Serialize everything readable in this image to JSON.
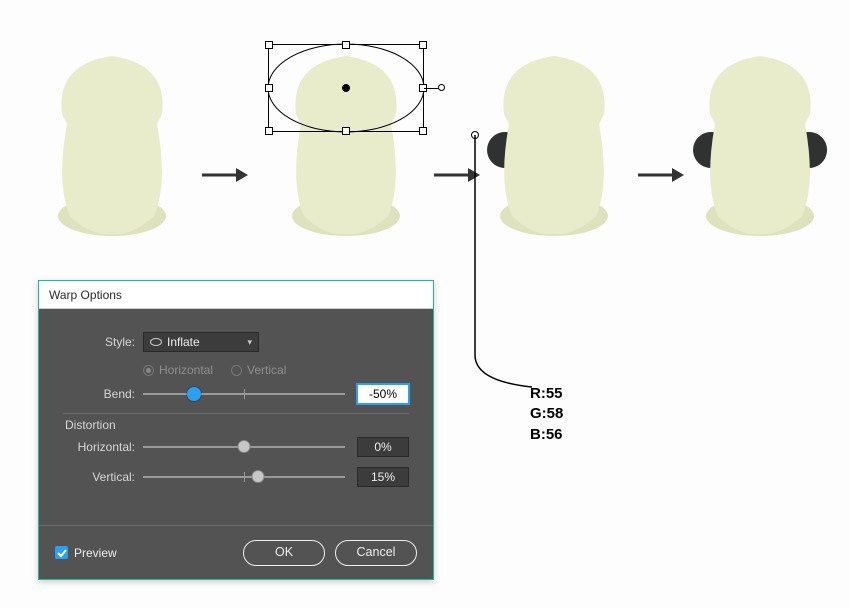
{
  "shape_fill": "#E9ECCB",
  "shape_shadow": "#DFE3BD",
  "ear_fill": "#2F3231",
  "callout_color": {
    "r_label": "R:55",
    "g_label": "G:58",
    "b_label": "B:56"
  },
  "dialog": {
    "title": "Warp Options",
    "style_label": "Style:",
    "style_value": "Inflate",
    "horiz_radio": "Horizontal",
    "vert_radio": "Vertical",
    "bend_label": "Bend:",
    "bend_value": "-50%",
    "bend_pct": 25,
    "distortion_heading": "Distortion",
    "h_label": "Horizontal:",
    "h_value": "0%",
    "h_pct": 50,
    "v_label": "Vertical:",
    "v_value": "15%",
    "v_pct": 57,
    "preview_label": "Preview",
    "ok_label": "OK",
    "cancel_label": "Cancel"
  }
}
